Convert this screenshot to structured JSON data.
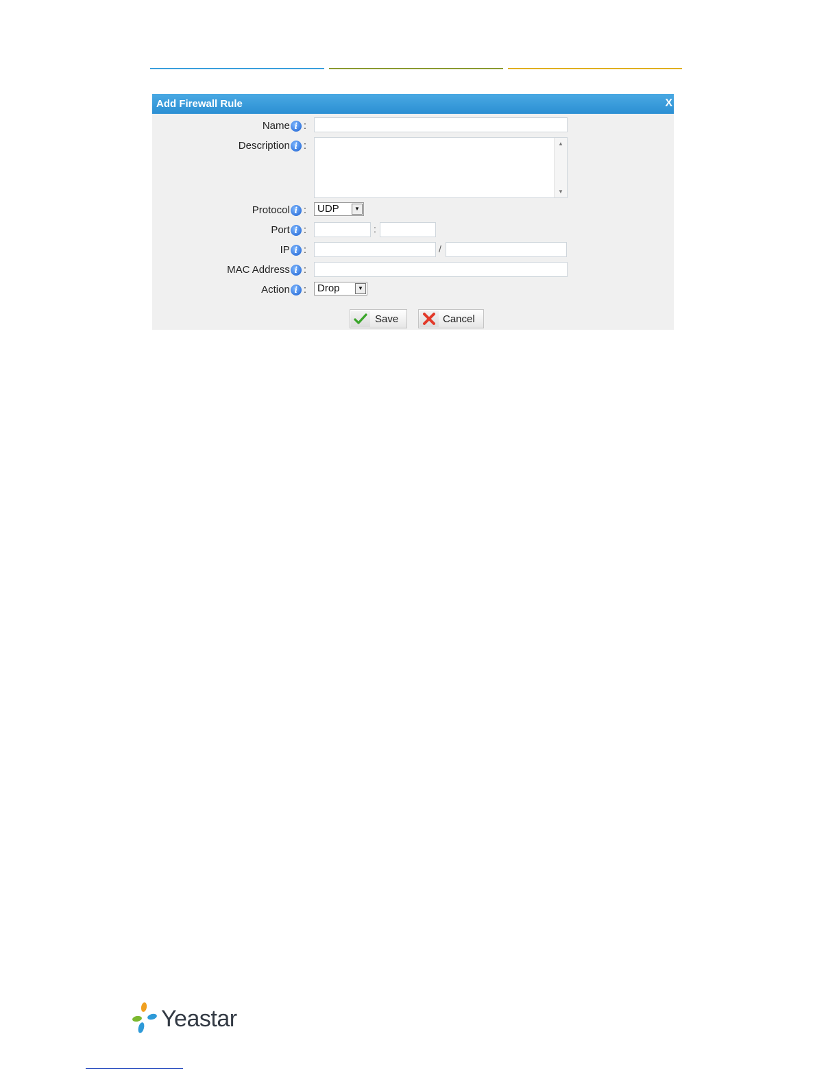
{
  "header_rule_colors": [
    "#3a9fdc",
    "#8a9a30",
    "#e0b020"
  ],
  "dialog": {
    "title": "Add Firewall Rule",
    "close_label": "X",
    "title_bar_color": "#2f93d6",
    "fields": {
      "name": {
        "label": "Name",
        "value": ""
      },
      "description": {
        "label": "Description",
        "value": ""
      },
      "protocol": {
        "label": "Protocol",
        "selected": "UDP"
      },
      "port": {
        "label": "Port",
        "start": "",
        "end": "",
        "separator": ":"
      },
      "ip": {
        "label": "IP",
        "address": "",
        "mask": "",
        "separator": "/"
      },
      "mac": {
        "label": "MAC Address",
        "value": ""
      },
      "action": {
        "label": "Action",
        "selected": "Drop"
      }
    },
    "buttons": {
      "save": "Save",
      "cancel": "Cancel"
    }
  },
  "footer": {
    "logo_text": "Yeastar"
  }
}
